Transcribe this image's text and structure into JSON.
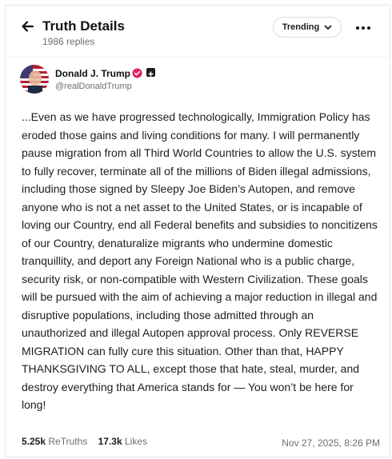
{
  "header": {
    "title": "Truth Details",
    "subtitle": "1986 replies",
    "sort_label": "Trending",
    "icons": [
      "arrow-left-icon",
      "chevron-down-icon",
      "more-horizontal-icon"
    ]
  },
  "author": {
    "name": "Donald J. Trump",
    "handle": "@realDonaldTrump",
    "verified_color": "#e0245e"
  },
  "post": {
    "text": "...Even as we have progressed technologically, Immigration Policy has eroded those gains and living conditions for many. I will permanently pause migration from all Third World Countries to allow the U.S. system to fully recover, terminate all of the millions of Biden illegal admissions, including those signed by Sleepy Joe Biden’s Autopen, and remove anyone who is not a net asset to the United States, or is incapable of loving our Country, end all Federal benefits and subsidies to noncitizens of our Country, denaturalize migrants who undermine domestic tranquillity, and deport any Foreign National who is a public charge, security risk, or non-compatible with Western Civilization. These goals will be pursued with the aim of achieving a major reduction in illegal and disruptive populations, including those admitted through an unauthorized and illegal Autopen approval process. Only REVERSE MIGRATION can fully cure this situation. Other than that, HAPPY THANKSGIVING TO ALL, except those that hate, steal, murder, and destroy everything that America stands for — You won’t be here for long!",
    "retruths_count": "5.25k",
    "retruths_label": "ReTruths",
    "likes_count": "17.3k",
    "likes_label": "Likes",
    "timestamp": "Nov 27, 2025, 8:26 PM"
  }
}
